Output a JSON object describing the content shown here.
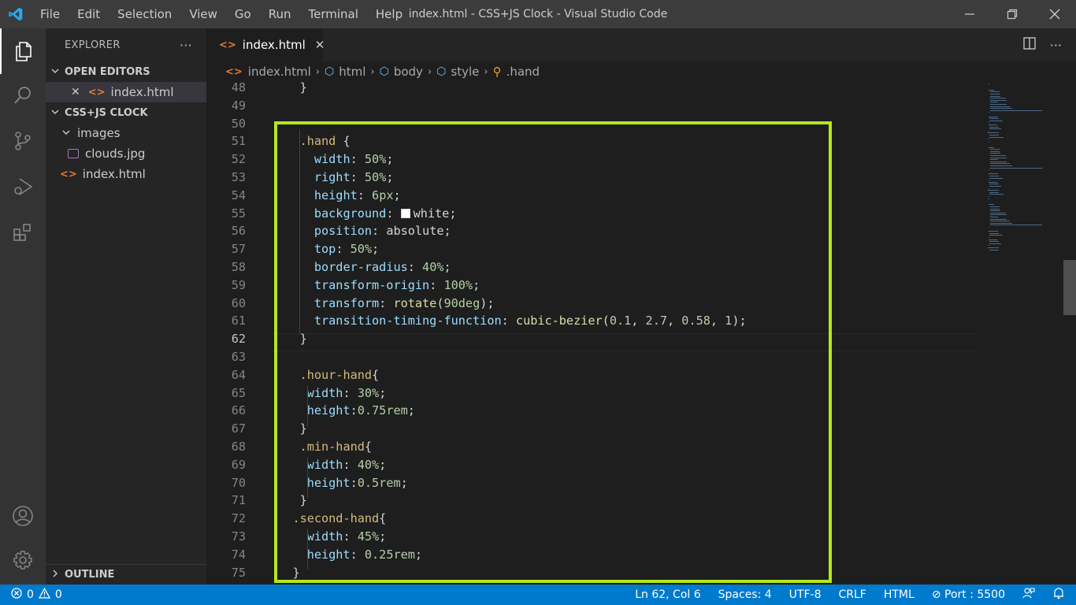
{
  "window": {
    "title": "index.html - CSS+JS Clock - Visual Studio Code",
    "controls": [
      "minimize",
      "restore",
      "close"
    ]
  },
  "menu": [
    "File",
    "Edit",
    "Selection",
    "View",
    "Go",
    "Run",
    "Terminal",
    "Help"
  ],
  "activity_bar": [
    "explorer-icon",
    "search-icon",
    "source-control-icon",
    "run-debug-icon",
    "extensions-icon",
    "accounts-icon",
    "settings-gear-icon"
  ],
  "sidebar": {
    "header": "EXPLORER",
    "more": "···",
    "open_editors": {
      "title": "OPEN EDITORS",
      "items": [
        {
          "close": "✕",
          "icon": "<>",
          "label": "index.html"
        }
      ]
    },
    "project": {
      "title": "CSS+JS CLOCK",
      "folder": "images",
      "files": [
        {
          "icon": "image-icon",
          "label": "clouds.jpg"
        },
        {
          "icon": "<>",
          "label": "index.html"
        }
      ]
    },
    "outline": "OUTLINE"
  },
  "tabs": [
    {
      "icon": "<>",
      "label": "index.html",
      "close": "✕"
    }
  ],
  "breadcrumb": [
    "index.html",
    "html",
    "body",
    "style",
    ".hand"
  ],
  "editor": {
    "current_line": 62,
    "lines": [
      {
        "n": "48",
        "text": "    }"
      },
      {
        "n": "49",
        "text": ""
      },
      {
        "n": "50",
        "text": ""
      },
      {
        "n": "51",
        "text": "    .hand {"
      },
      {
        "n": "52",
        "text": "      width: 50%;"
      },
      {
        "n": "53",
        "text": "      right: 50%;"
      },
      {
        "n": "54",
        "text": "      height: 6px;"
      },
      {
        "n": "55",
        "text": "      background: white;"
      },
      {
        "n": "56",
        "text": "      position: absolute;"
      },
      {
        "n": "57",
        "text": "      top: 50%;"
      },
      {
        "n": "58",
        "text": "      border-radius: 40%;"
      },
      {
        "n": "59",
        "text": "      transform-origin: 100%;"
      },
      {
        "n": "60",
        "text": "      transform: rotate(90deg);"
      },
      {
        "n": "61",
        "text": "      transition-timing-function: cubic-bezier(0.1, 2.7, 0.58, 1);"
      },
      {
        "n": "62",
        "text": "    }"
      },
      {
        "n": "63",
        "text": ""
      },
      {
        "n": "64",
        "text": "    .hour-hand{"
      },
      {
        "n": "65",
        "text": "     width: 30%;"
      },
      {
        "n": "66",
        "text": "     height:0.75rem;"
      },
      {
        "n": "67",
        "text": "    }"
      },
      {
        "n": "68",
        "text": "    .min-hand{"
      },
      {
        "n": "69",
        "text": "     width: 40%;"
      },
      {
        "n": "70",
        "text": "     height:0.5rem;"
      },
      {
        "n": "71",
        "text": "    }"
      },
      {
        "n": "72",
        "text": "   .second-hand{"
      },
      {
        "n": "73",
        "text": "     width: 45%;"
      },
      {
        "n": "74",
        "text": "     height: 0.25rem;"
      },
      {
        "n": "75",
        "text": "   }"
      }
    ]
  },
  "status_bar": {
    "errors": "0",
    "warnings": "0",
    "position": "Ln 62, Col 6",
    "spaces": "Spaces: 4",
    "encoding": "UTF-8",
    "eol": "CRLF",
    "language": "HTML",
    "port": "Port : 5500"
  },
  "colors": {
    "highlight_box": "#b5e61d",
    "status_bar": "#007acc",
    "selector": "#d7ba7d",
    "property": "#9cdcfe",
    "number": "#b5cea8"
  }
}
